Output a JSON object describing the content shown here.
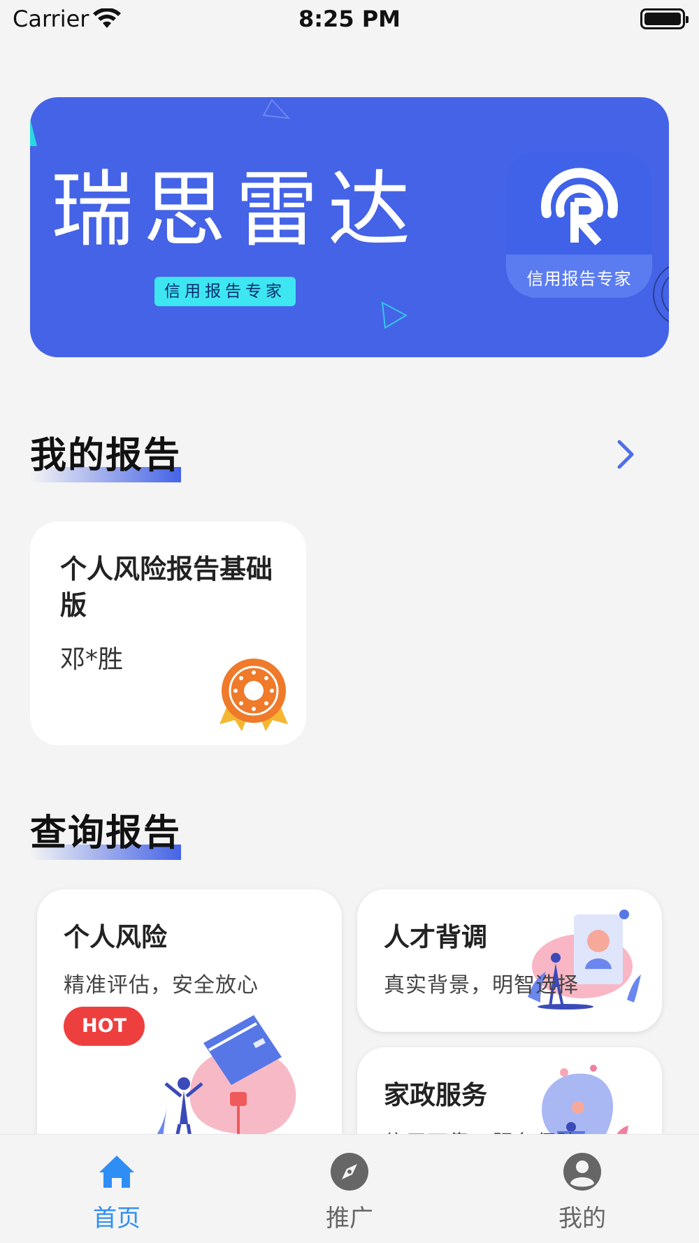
{
  "status_bar": {
    "carrier": "Carrier",
    "time": "8:25 PM"
  },
  "banner": {
    "title": "瑞思雷达",
    "tag": "信用报告专家",
    "logo_text": "信用报告专家"
  },
  "my_reports": {
    "title": "我的报告",
    "items": [
      {
        "name": "个人风险报告基础版",
        "person": "邓*胜"
      }
    ]
  },
  "query_reports": {
    "title": "查询报告",
    "cards": [
      {
        "title": "个人风险",
        "desc": "精准评估，安全放心",
        "badge": "HOT"
      },
      {
        "title": "人才背调",
        "desc": "真实背景，明智选择"
      },
      {
        "title": "家政服务",
        "desc": "信用可靠，服务保障"
      }
    ]
  },
  "tab_bar": {
    "tabs": [
      {
        "label": "首页",
        "icon": "home-icon",
        "active": true
      },
      {
        "label": "推广",
        "icon": "compass-icon",
        "active": false
      },
      {
        "label": "我的",
        "icon": "person-icon",
        "active": false
      }
    ]
  },
  "colors": {
    "primary": "#4563e6",
    "tab_active": "#2f8ef4",
    "hot": "#ee3f3f",
    "tag": "#3ee6f2",
    "medal": "#ee7a2a"
  }
}
